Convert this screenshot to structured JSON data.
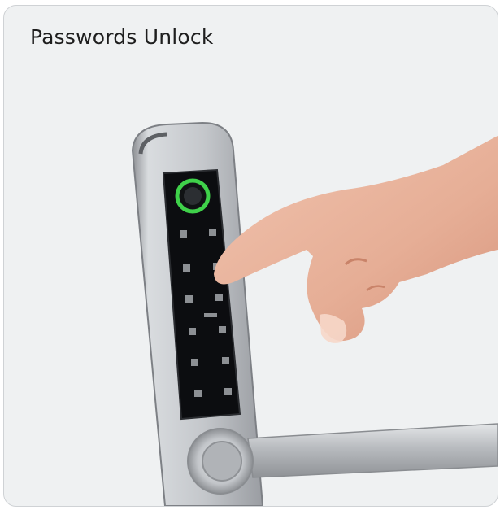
{
  "card": {
    "title": "Passwords Unlock"
  },
  "colors": {
    "card_background": "#eff1f2",
    "lock_body": "#c9ccd0",
    "keypad_panel": "#0c0d10",
    "fingerprint_ring": "#3fd14a",
    "skin": "#e9b69f"
  },
  "illustration": {
    "subject": "hand-pressing-smart-lock-keypad",
    "icons": [
      "fingerprint-sensor-icon",
      "keypad-digit-icon",
      "door-handle-icon"
    ]
  }
}
